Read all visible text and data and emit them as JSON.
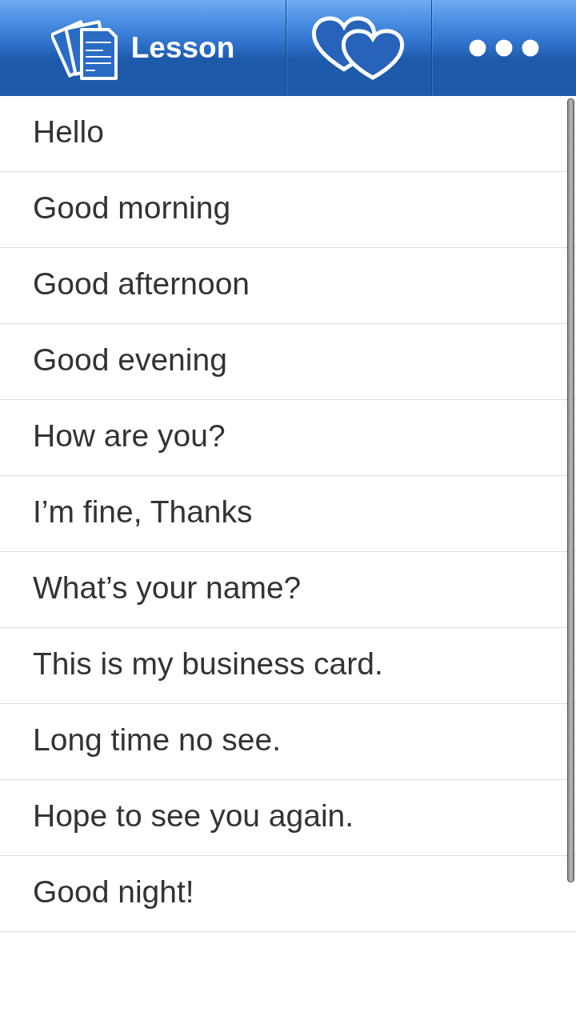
{
  "header": {
    "title": "Lesson"
  },
  "phrases": [
    "Hello",
    "Good morning",
    "Good afternoon",
    "Good evening",
    "How are you?",
    "I’m fine, Thanks",
    "What’s your name?",
    "This is my business card.",
    "Long time no see.",
    "Hope to see you again.",
    "Good night!"
  ]
}
